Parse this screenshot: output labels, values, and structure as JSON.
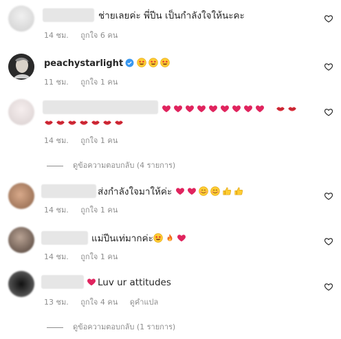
{
  "comments": [
    {
      "text": "ช่ายเลยค่ะ พี่ปีน เป็นกำลังใจให้นะคะ",
      "time": "14 ชม.",
      "likes": "ถูกใจ 6 คน"
    },
    {
      "username": "peachystarlight",
      "time": "11 ชม.",
      "likes": "ถูกใจ 1 คน"
    },
    {
      "time": "14 ชม.",
      "likes": "ถูกใจ 1 คน",
      "replies": "ดูข้อความตอบกลับ (4 รายการ)"
    },
    {
      "text": "ส่งกำลังใจมาให้ค่ะ",
      "time": "14 ชม.",
      "likes": "ถูกใจ 1 คน"
    },
    {
      "text": "แม่ปีนเท่มากค่ะ",
      "time": "14 ชม.",
      "likes": "ถูกใจ 1 คน"
    },
    {
      "text": "Luv ur attitudes",
      "time": "13 ชม.",
      "likes": "ถูกใจ 4 คน",
      "translate": "ดูคำแปล",
      "replies": "ดูข้อความตอบกลับ (1 รายการ)"
    }
  ],
  "icons": {
    "like": "heart-outline-icon",
    "verified": "verified-badge-icon"
  },
  "colors": {
    "heart": "#e0245e",
    "lips": "#d92d3a",
    "meta": "#8e8e8e",
    "verified": "#3897f0"
  }
}
